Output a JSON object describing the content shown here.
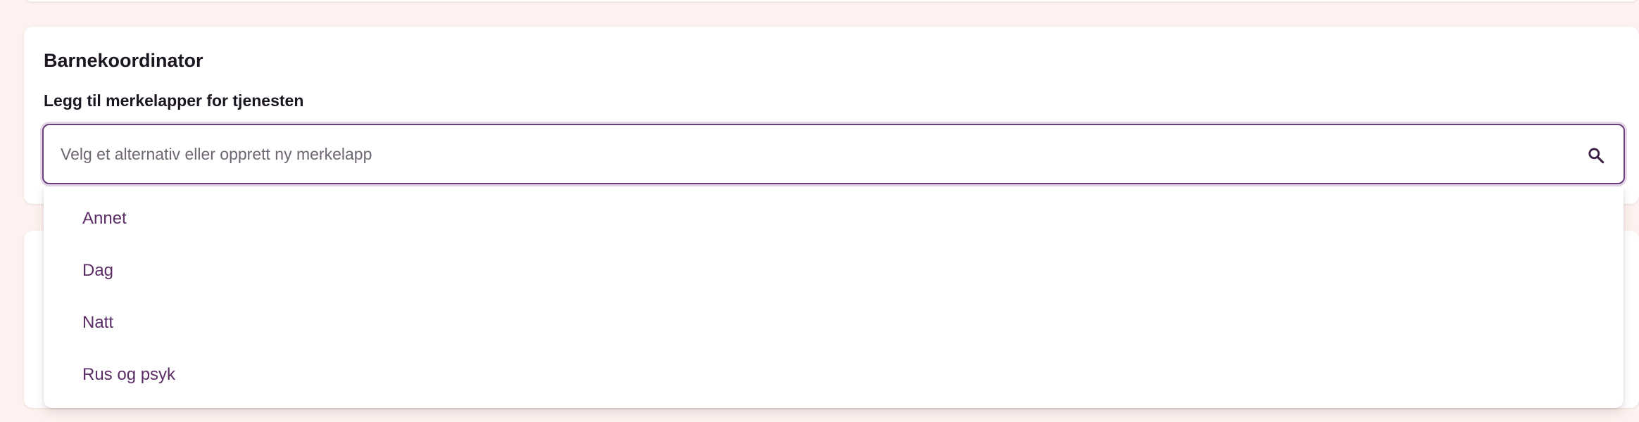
{
  "section": {
    "title": "Barnekoordinator",
    "field_label": "Legg til merkelapper for tjenesten",
    "combo": {
      "placeholder": "Velg et alternativ eller opprett ny merkelapp",
      "value": "",
      "icon": "search-icon"
    },
    "options": [
      {
        "label": "Annet"
      },
      {
        "label": "Dag"
      },
      {
        "label": "Natt"
      },
      {
        "label": "Rus og psyk"
      }
    ]
  },
  "colors": {
    "page_background": "#fdf2ef",
    "accent": "#6b3f7a",
    "option_text": "#5b2d66"
  }
}
